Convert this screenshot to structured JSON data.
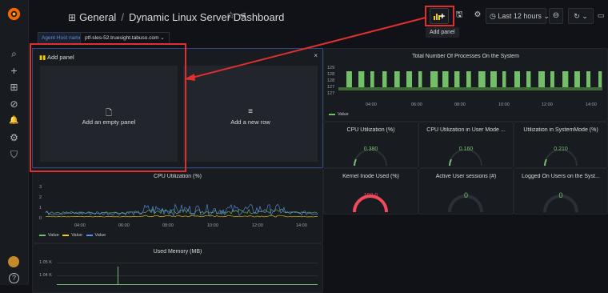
{
  "header": {
    "folder": "General",
    "separator": "/",
    "dashboard": "Dynamic Linux Server Dashboard",
    "star_icon": "☆",
    "share_icon": "⋖",
    "time_range": "Last 12 hours",
    "tooltip": "Add panel"
  },
  "variables": {
    "label": "Agent Host name",
    "value": "ptf-sles-52.truesight.tabuso.com ⌄"
  },
  "add_panel": {
    "title": "Add panel",
    "close": "×",
    "options": [
      {
        "label": "Add an empty panel",
        "icon": "🗋"
      },
      {
        "label": "Add a new row",
        "icon": "≡"
      }
    ]
  },
  "processes": {
    "title": "Total Number Of Processes On the System",
    "y_ticks": [
      "129",
      "128",
      "128",
      "127",
      "127"
    ],
    "x_ticks": [
      "04:00",
      "06:00",
      "08:00",
      "10:00",
      "12:00",
      "14:00"
    ],
    "legend": "Value",
    "color": "#73bf69"
  },
  "gauges": [
    {
      "title": "CPU Utilization (%)",
      "value": "0.380"
    },
    {
      "title": "CPU Utilization in User Mode ...",
      "value": "0.160"
    },
    {
      "title": "Utilization in SystemMode (%)",
      "value": "0.210"
    }
  ],
  "stats": [
    {
      "title": "Kernel Inode Used (%)",
      "value": "100.0",
      "color": "#f2495c"
    },
    {
      "title": "Active User sessions (#)",
      "value": "0",
      "color": "#73bf69"
    },
    {
      "title": "Logged On Users on the Syst...",
      "value": "0",
      "color": "#73bf69"
    }
  ],
  "cpu_chart": {
    "title": "CPU Utilization (%)",
    "y_ticks": [
      "3",
      "2",
      "1",
      "0"
    ],
    "x_ticks": [
      "04:00",
      "06:00",
      "08:00",
      "10:00",
      "12:00",
      "14:00"
    ],
    "legend": [
      {
        "name": "Value",
        "color": "#73bf69"
      },
      {
        "name": "Value",
        "color": "#f2cc0c"
      },
      {
        "name": "Value",
        "color": "#5794f2"
      }
    ]
  },
  "memory": {
    "title": "Used Memory (MB)",
    "y_ticks": [
      "1.05 K",
      "1.04 K"
    ]
  },
  "sidebar_icons": [
    "⌕",
    "+",
    "⊞",
    "⊘",
    "🔔",
    "⚙",
    "⛉"
  ],
  "help_icon": "?"
}
